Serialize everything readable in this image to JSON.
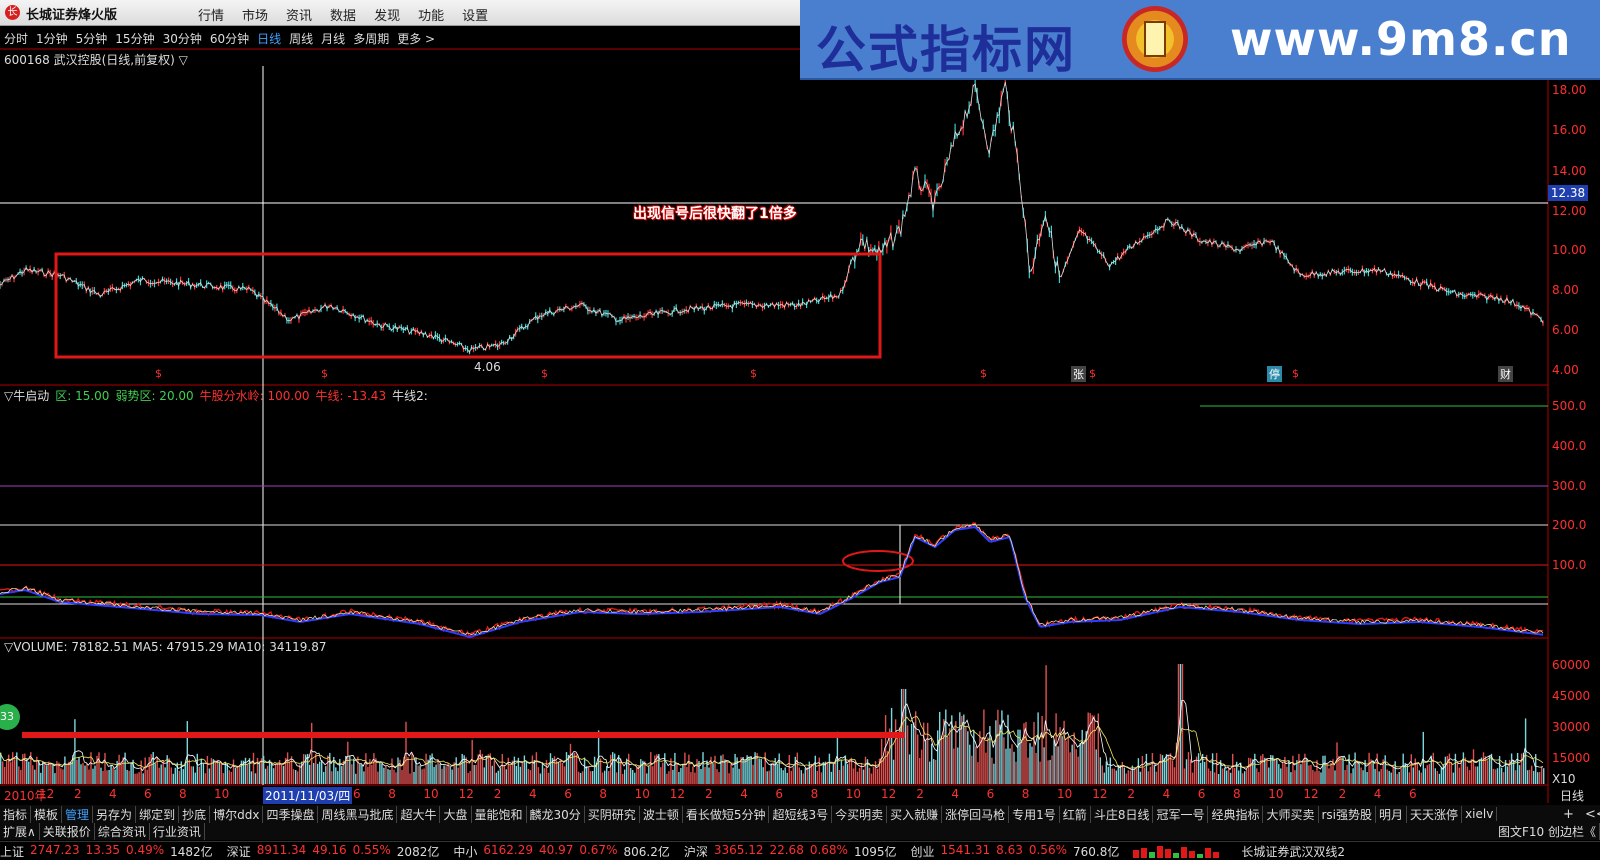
{
  "titlebar": {
    "app_title": "长城证券烽火版",
    "menu": [
      "行情",
      "市场",
      "资讯",
      "数据",
      "发现",
      "功能",
      "设置"
    ]
  },
  "watermark": {
    "text_cn": "公式指标网",
    "url": "www.9m8.cn"
  },
  "periods": [
    "分时",
    "1分钟",
    "5分钟",
    "15分钟",
    "30分钟",
    "60分钟",
    "日线",
    "周线",
    "月线",
    "多周期",
    "更多 >"
  ],
  "active_period": "日线",
  "stock_line": "600168 武汉控股(日线,前复权) ▽",
  "price_axis": [
    "18.00",
    "16.00",
    "14.00",
    "12.00",
    "10.00",
    "8.00",
    "6.00",
    "4.00"
  ],
  "price_tag": "12.38",
  "annotation": "出现信号后很快翻了1倍多",
  "low_label": "4.06",
  "chart_symbols": {
    "s": "$",
    "zhang": "张",
    "ting": "停",
    "cai": "财"
  },
  "indicator": {
    "legend": [
      {
        "text": "▽牛启动",
        "color": "#dddddd"
      },
      {
        "text": "区: 15.00",
        "color": "#3fd050"
      },
      {
        "text": "弱势区: 20.00",
        "color": "#3fd050"
      },
      {
        "text": "牛股分水岭: 100.00",
        "color": "#ff3030"
      },
      {
        "text": "牛线: -13.43",
        "color": "#ff3030"
      },
      {
        "text": "牛线2:",
        "color": "#dddddd"
      }
    ],
    "axis": [
      "500.0",
      "400.0",
      "300.0",
      "200.0",
      "100.0"
    ]
  },
  "volume": {
    "legend": "▽VOLUME: 78182.51  MA5: 47915.29  MA10: 34119.87",
    "axis": [
      "60000",
      "45000",
      "30000",
      "15000"
    ],
    "unit": "X10",
    "circle_label": "33"
  },
  "date_axis": {
    "labels": [
      "2010年",
      "12",
      "2",
      "4",
      "6",
      "8",
      "10",
      "2011/11/03/四",
      "6",
      "8",
      "10",
      "12",
      "2",
      "4",
      "6",
      "8",
      "10",
      "12",
      "2",
      "4",
      "6",
      "8",
      "10",
      "12",
      "2",
      "4",
      "6",
      "8",
      "10",
      "12",
      "2",
      "4",
      "6",
      "8",
      "10",
      "12",
      "2",
      "4",
      "6"
    ],
    "period_name": "日线"
  },
  "tabs1": [
    "指标",
    "模板",
    "管理",
    "另存为",
    "绑定到",
    "抄底",
    "博尔ddx",
    "四季操盘",
    "周线黑马批底",
    "超大牛",
    "大盘",
    "量能饱和",
    "麟龙30分",
    "买阴研究",
    "波士顿",
    "看长做短5分钟",
    "超短线3号",
    "今买明卖",
    "买入就赚",
    "涨停回马枪",
    "专用1号",
    "红箭",
    "斗庄8日线",
    "冠军一号",
    "经典指标",
    "大师买卖",
    "rsi强势股",
    "明月",
    "天天涨停",
    "xielv"
  ],
  "tabs1_active": "管理",
  "tabs1_right": [
    "+",
    "<<"
  ],
  "tabs2": [
    "扩展∧",
    "关联报价",
    "综合资讯",
    "行业资讯"
  ],
  "tabs2_right": "图文F10  创边栏《",
  "ticker": [
    {
      "name": "上证",
      "price": "2747.23",
      "chg": "13.35",
      "pct": "0.49%",
      "amt": "1482亿"
    },
    {
      "name": "深证",
      "price": "8911.34",
      "chg": "49.16",
      "pct": "0.55%",
      "amt": "2082亿"
    },
    {
      "name": "中小",
      "price": "6162.29",
      "chg": "40.97",
      "pct": "0.67%",
      "amt": "806.2亿"
    },
    {
      "name": "沪深",
      "price": "3365.12",
      "chg": "22.68",
      "pct": "0.68%",
      "amt": "1095亿"
    },
    {
      "name": "创业",
      "price": "1541.31",
      "chg": "8.63",
      "pct": "0.56%",
      "amt": "760.8亿"
    }
  ],
  "broker_text": "长城证券武汉双线2",
  "colors": {
    "up": "#ff3030",
    "down": "#3ad0d0",
    "ma_blue": "#2a3fff",
    "box_red": "#e01818",
    "white": "#ffffff"
  }
}
